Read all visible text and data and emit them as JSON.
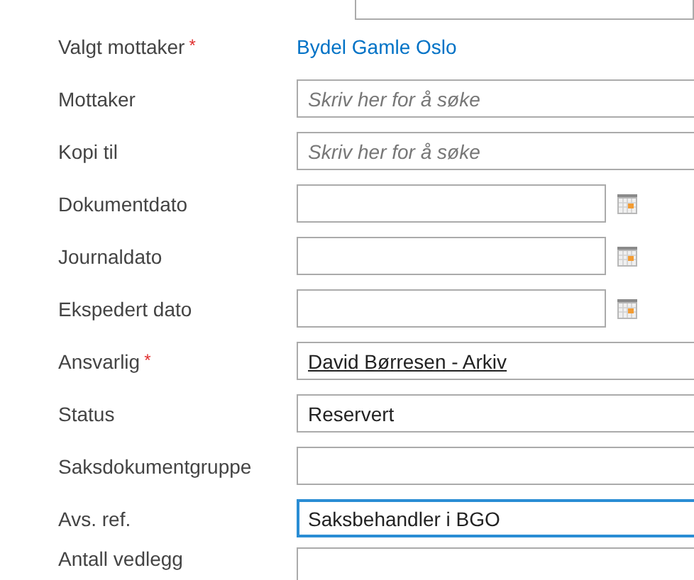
{
  "fields": [
    {
      "label": "Valgt mottaker",
      "required_mark": "*",
      "kind": "link",
      "value": "Bydel Gamle Oslo"
    },
    {
      "label": "Mottaker",
      "kind": "search",
      "placeholder": "Skriv her for å søke"
    },
    {
      "label": "Kopi til",
      "kind": "search",
      "placeholder": "Skriv her for å søke"
    },
    {
      "label": "Dokumentdato",
      "kind": "date"
    },
    {
      "label": "Journaldato",
      "kind": "date"
    },
    {
      "label": "Ekspedert dato",
      "kind": "date"
    },
    {
      "label": "Ansvarlig",
      "required_mark": "*",
      "kind": "person",
      "value": "David Børresen - Arkiv"
    },
    {
      "label": "Status",
      "kind": "text",
      "value": "Reservert"
    },
    {
      "label": "Saksdokumentgruppe",
      "kind": "text"
    },
    {
      "label": "Avs. ref.",
      "kind": "text",
      "value": "Saksbehandler i BGO",
      "focused": true
    },
    {
      "label": "Antall vedlegg",
      "kind": "text"
    }
  ]
}
